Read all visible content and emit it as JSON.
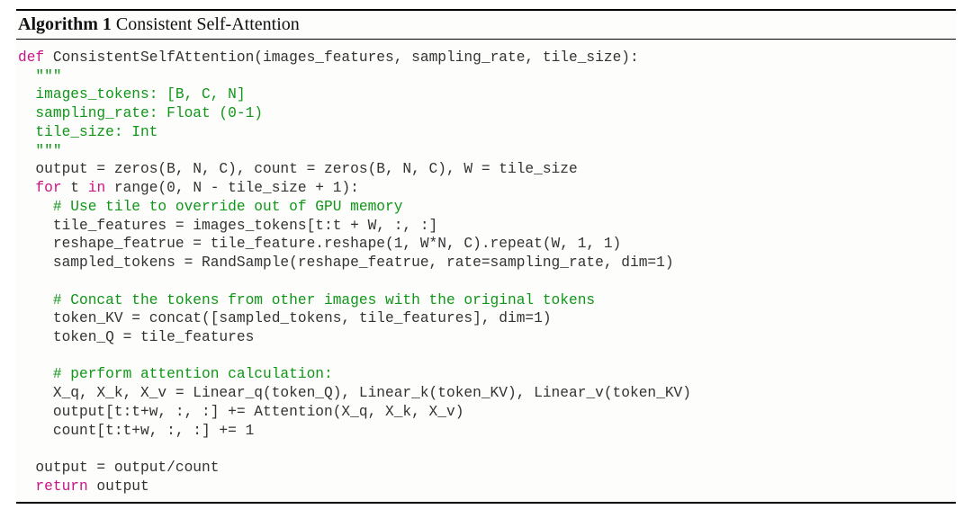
{
  "header": {
    "label": "Algorithm 1",
    "title": "Consistent Self-Attention"
  },
  "code": {
    "l01_def": "def",
    "l01_rest": " ConsistentSelfAttention(images_features, sampling_rate, tile_size):",
    "l02": "  \"\"\"",
    "l03": "  images_tokens: [B, C, N]",
    "l04": "  sampling_rate: Float (0-1)",
    "l05": "  tile_size: Int",
    "l06": "  \"\"\"",
    "l07": "  output = zeros(B, N, C), count = zeros(B, N, C), W = tile_size",
    "l08_for": "  for",
    "l08_mid": " t ",
    "l08_in": "in",
    "l08_rest": " range(0, N - tile_size + 1):",
    "l09": "    # Use tile to override out of GPU memory",
    "l10": "    tile_features = images_tokens[t:t + W, :, :]",
    "l11": "    reshape_featrue = tile_feature.reshape(1, W*N, C).repeat(W, 1, 1)",
    "l12": "    sampled_tokens = RandSample(reshape_featrue, rate=sampling_rate, dim=1)",
    "l13": "",
    "l14": "    # Concat the tokens from other images with the original tokens",
    "l15": "    token_KV = concat([sampled_tokens, tile_features], dim=1)",
    "l16": "    token_Q = tile_features",
    "l17": "",
    "l18": "    # perform attention calculation:",
    "l19": "    X_q, X_k, X_v = Linear_q(token_Q), Linear_k(token_KV), Linear_v(token_KV)",
    "l20": "    output[t:t+w, :, :] += Attention(X_q, X_k, X_v)",
    "l21": "    count[t:t+w, :, :] += 1",
    "l22": "",
    "l23": "  output = output/count",
    "l24_ret": "  return",
    "l24_rest": " output"
  }
}
